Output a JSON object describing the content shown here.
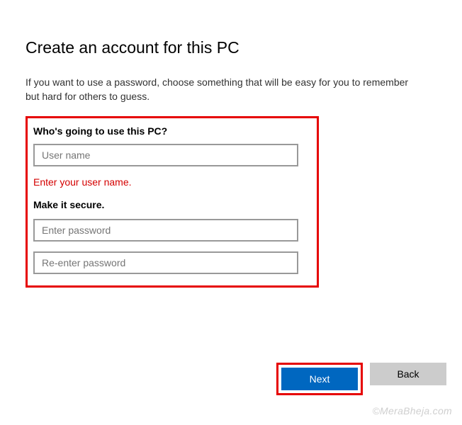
{
  "title": "Create an account for this PC",
  "subtitle": "If you want to use a password, choose something that will be easy for you to remember but hard for others to guess.",
  "form": {
    "who_label": "Who's going to use this PC?",
    "username_placeholder": "User name",
    "username_value": "",
    "error": "Enter your user name.",
    "secure_label": "Make it secure.",
    "password_placeholder": "Enter password",
    "password_value": "",
    "repassword_placeholder": "Re-enter password",
    "repassword_value": ""
  },
  "buttons": {
    "next": "Next",
    "back": "Back"
  },
  "watermark": "©MeraBheja.com"
}
